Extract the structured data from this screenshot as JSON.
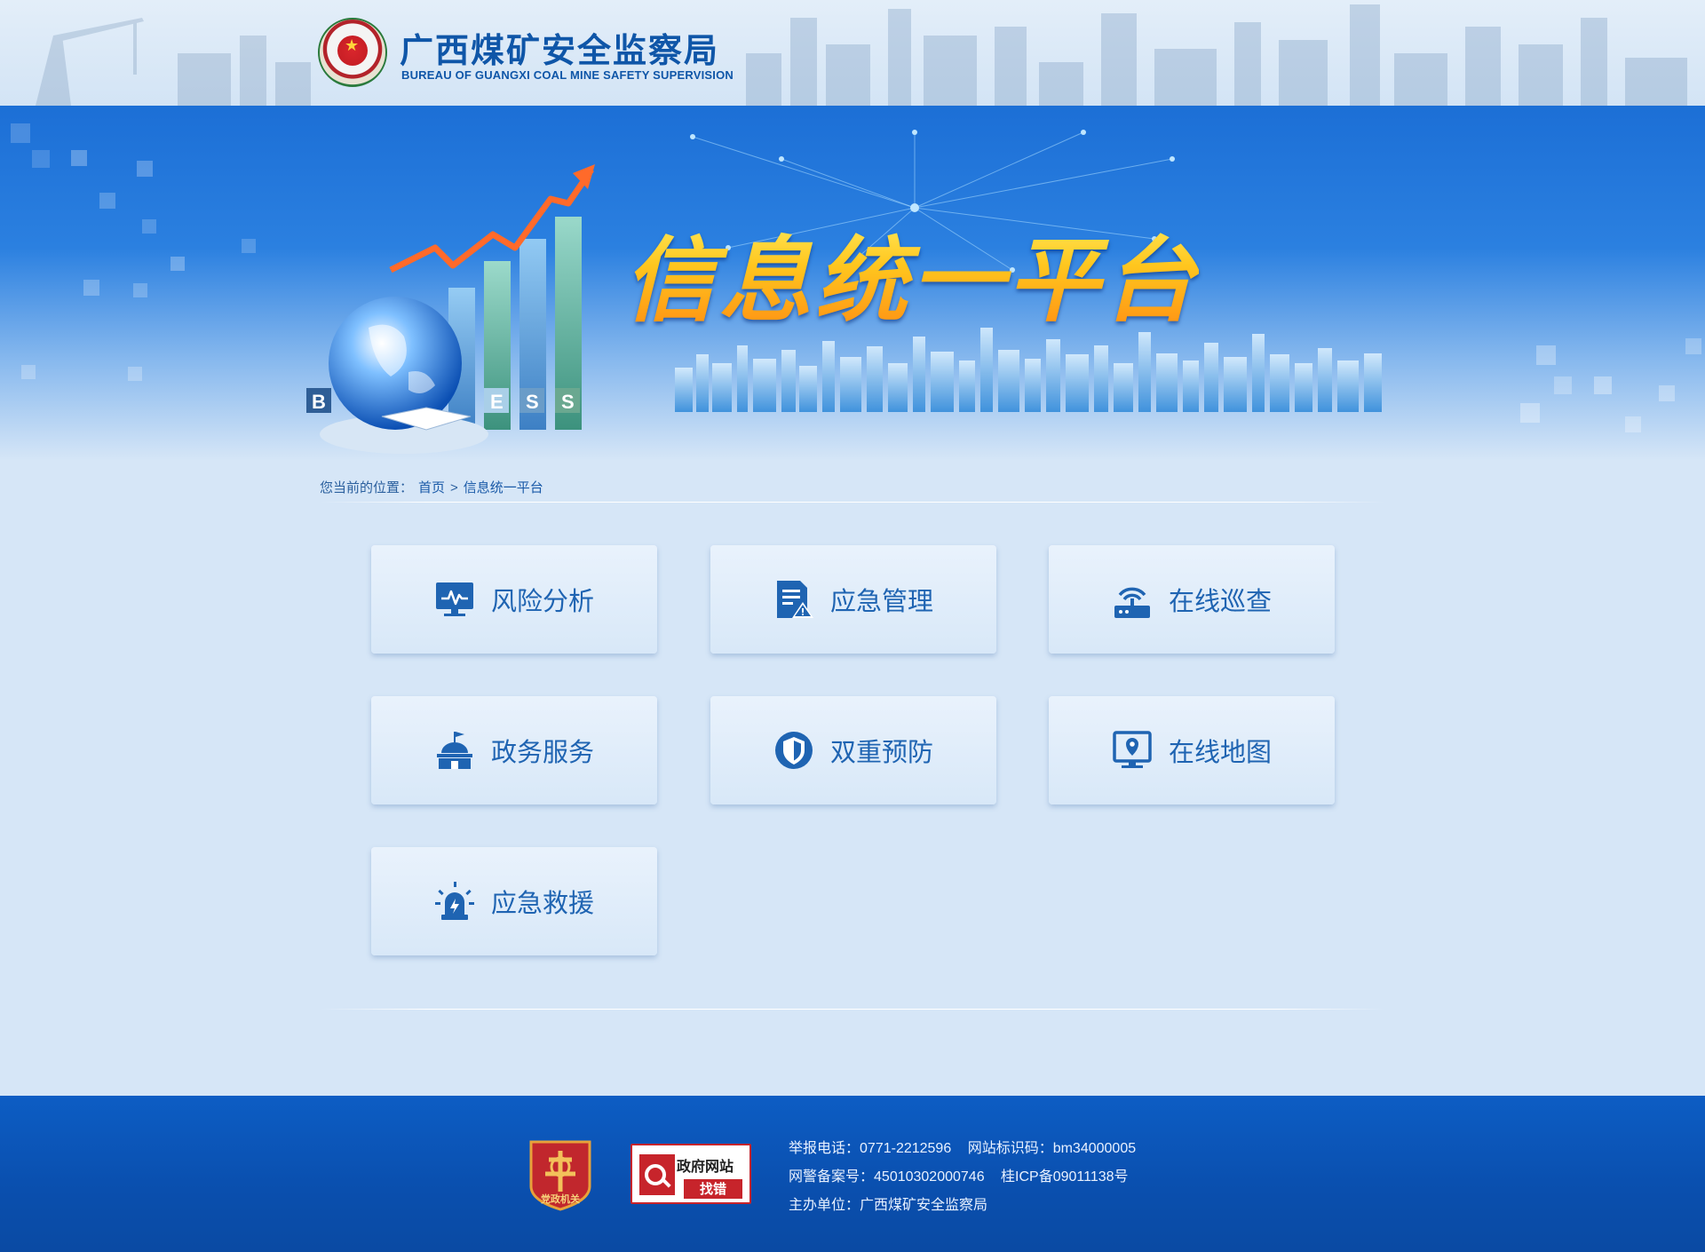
{
  "header": {
    "org_name_cn": "广西煤矿安全监察局",
    "org_name_en": "BUREAU OF GUANGXI COAL MINE SAFETY SUPERVISION"
  },
  "banner": {
    "title": "信息统一平台",
    "bar_letters": [
      "B",
      "E",
      "S",
      "S"
    ]
  },
  "breadcrumb": {
    "prefix": "您当前的位置：",
    "home": "首页",
    "separator": ">",
    "current": "信息统一平台"
  },
  "tiles": [
    {
      "label": "风险分析",
      "icon": "monitor-chart-icon"
    },
    {
      "label": "应急管理",
      "icon": "document-warning-icon"
    },
    {
      "label": "在线巡查",
      "icon": "router-signal-icon"
    },
    {
      "label": "政务服务",
      "icon": "government-building-icon"
    },
    {
      "label": "双重预防",
      "icon": "shield-icon"
    },
    {
      "label": "在线地图",
      "icon": "map-pin-monitor-icon"
    },
    {
      "label": "应急救援",
      "icon": "alarm-light-icon"
    }
  ],
  "footer": {
    "party_badge_text": "党政机关",
    "gov_badge_top": "政府网站",
    "gov_badge_bottom": "找错",
    "report_phone_label": "举报电话：",
    "report_phone": "0771-2212596",
    "site_id_label": "网站标识码：",
    "site_id": "bm34000005",
    "police_record_label": "网警备案号：",
    "police_record": "45010302000746",
    "icp": "桂ICP备09011138号",
    "host_label": "主办单位：",
    "host": "广西煤矿安全监察局"
  },
  "colors": {
    "brand_blue": "#0f56a8",
    "tile_text": "#1f64b2",
    "footer_bg": "#0a4fae",
    "title_orange": "#ffb21a"
  }
}
